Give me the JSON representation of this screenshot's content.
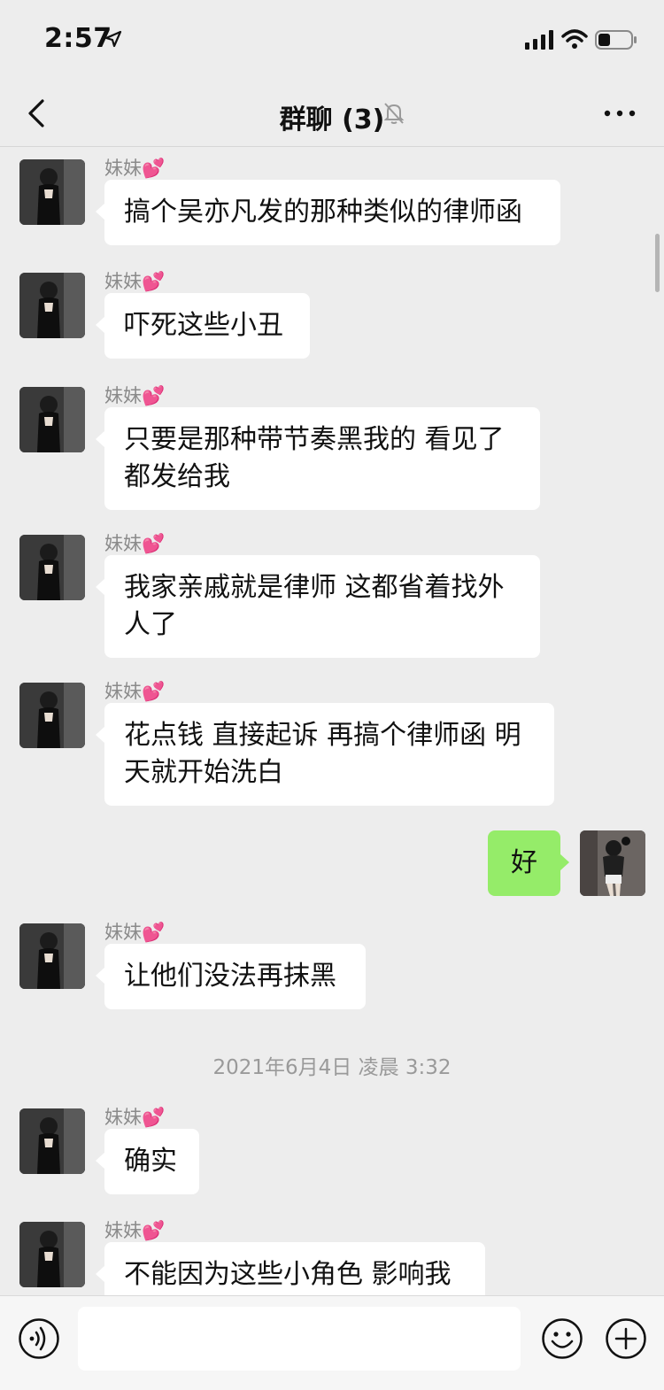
{
  "status": {
    "time": "2:57"
  },
  "nav": {
    "title": "群聊 (3)"
  },
  "contact": {
    "name": "妹妹💕"
  },
  "messages": [
    {
      "side": "left",
      "text": "搞个吴亦凡发的那种类似的律师函"
    },
    {
      "side": "left",
      "text": "吓死这些小丑"
    },
    {
      "side": "left",
      "text": "只要是那种带节奏黑我的 看见了都发给我"
    },
    {
      "side": "left",
      "text": "我家亲戚就是律师 这都省着找外人了"
    },
    {
      "side": "left",
      "text": "花点钱 直接起诉 再搞个律师函 明天就开始洗白"
    },
    {
      "side": "right",
      "text": "好"
    },
    {
      "side": "left",
      "text": "让他们没法再抹黑"
    },
    {
      "timestamp": "2021年6月4日 凌晨 3:32"
    },
    {
      "side": "left",
      "text": "确实"
    },
    {
      "side": "left",
      "text": "不能因为这些小角色 影响我"
    }
  ],
  "input": {
    "placeholder": ""
  },
  "colors": {
    "background": "#ededed",
    "my_bubble": "#95ec69",
    "their_bubble": "#ffffff"
  }
}
